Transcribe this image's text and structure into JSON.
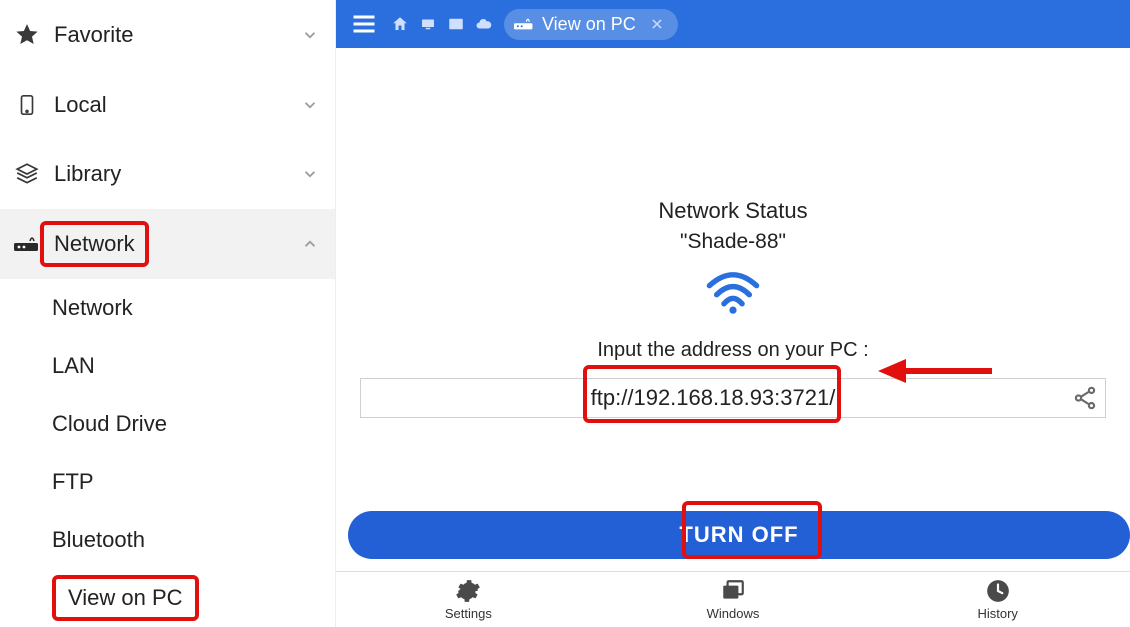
{
  "sidebar": {
    "items": [
      {
        "label": "Favorite"
      },
      {
        "label": "Local"
      },
      {
        "label": "Library"
      },
      {
        "label": "Network"
      }
    ],
    "network_children": [
      {
        "label": "Network"
      },
      {
        "label": "LAN"
      },
      {
        "label": "Cloud Drive"
      },
      {
        "label": "FTP"
      },
      {
        "label": "Bluetooth"
      },
      {
        "label": "View on PC"
      }
    ]
  },
  "topbar": {
    "tab_label": "View on PC"
  },
  "content": {
    "status_title": "Network Status",
    "network_name": "\"Shade-88\"",
    "instruction": "Input the address on your PC :",
    "address": "ftp://192.168.18.93:3721/",
    "turn_off_label": "TURN OFF"
  },
  "bottomnav": {
    "settings": "Settings",
    "windows": "Windows",
    "history": "History"
  },
  "colors": {
    "primary": "#2a6fdd",
    "highlight": "#e20f0f"
  }
}
